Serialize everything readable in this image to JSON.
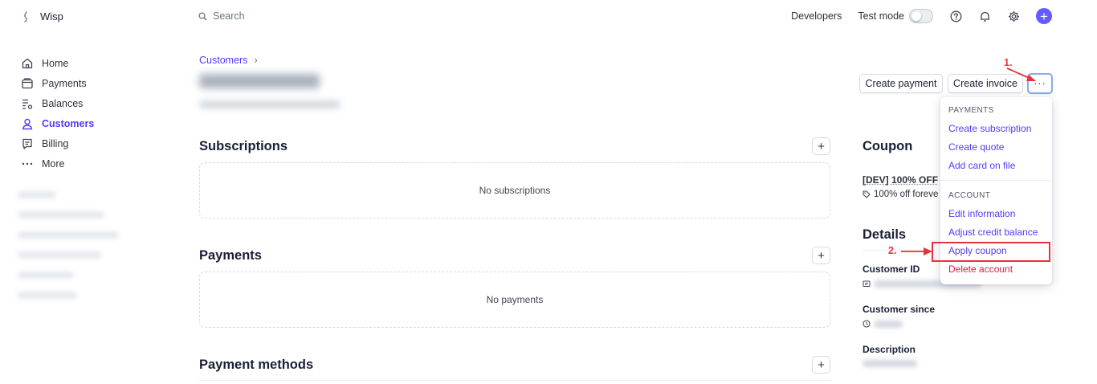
{
  "app": {
    "name": "Wisp"
  },
  "search": {
    "placeholder": "Search"
  },
  "topbar": {
    "developers": "Developers",
    "test_mode": "Test mode"
  },
  "sidebar": {
    "items": [
      {
        "label": "Home",
        "icon": "home-icon"
      },
      {
        "label": "Payments",
        "icon": "payments-icon"
      },
      {
        "label": "Balances",
        "icon": "balances-icon"
      },
      {
        "label": "Customers",
        "icon": "customers-icon",
        "active": true
      },
      {
        "label": "Billing",
        "icon": "billing-icon"
      },
      {
        "label": "More",
        "icon": "more-icon"
      }
    ]
  },
  "breadcrumb": {
    "label": "Customers"
  },
  "actions": {
    "create_payment": "Create payment",
    "create_invoice": "Create invoice",
    "more": "···"
  },
  "sections": {
    "subscriptions": {
      "title": "Subscriptions",
      "empty": "No subscriptions"
    },
    "payments": {
      "title": "Payments",
      "empty": "No payments"
    },
    "payment_methods": {
      "title": "Payment methods"
    }
  },
  "coupon": {
    "title": "Coupon",
    "name": "[DEV] 100% OFF",
    "desc": "100% off foreve"
  },
  "details": {
    "title": "Details",
    "customer_id": "Customer ID",
    "customer_since": "Customer since",
    "description": "Description"
  },
  "menu": {
    "payments_head": "PAYMENTS",
    "create_subscription": "Create subscription",
    "create_quote": "Create quote",
    "add_card": "Add card on file",
    "account_head": "ACCOUNT",
    "edit_information": "Edit information",
    "adjust_credit": "Adjust credit balance",
    "apply_coupon": "Apply coupon",
    "delete_account": "Delete account"
  },
  "annotations": {
    "step1": "1.",
    "step2": "2."
  },
  "colors": {
    "accent": "#533afd",
    "danger": "#df1b41",
    "annotation": "#e8323c"
  }
}
